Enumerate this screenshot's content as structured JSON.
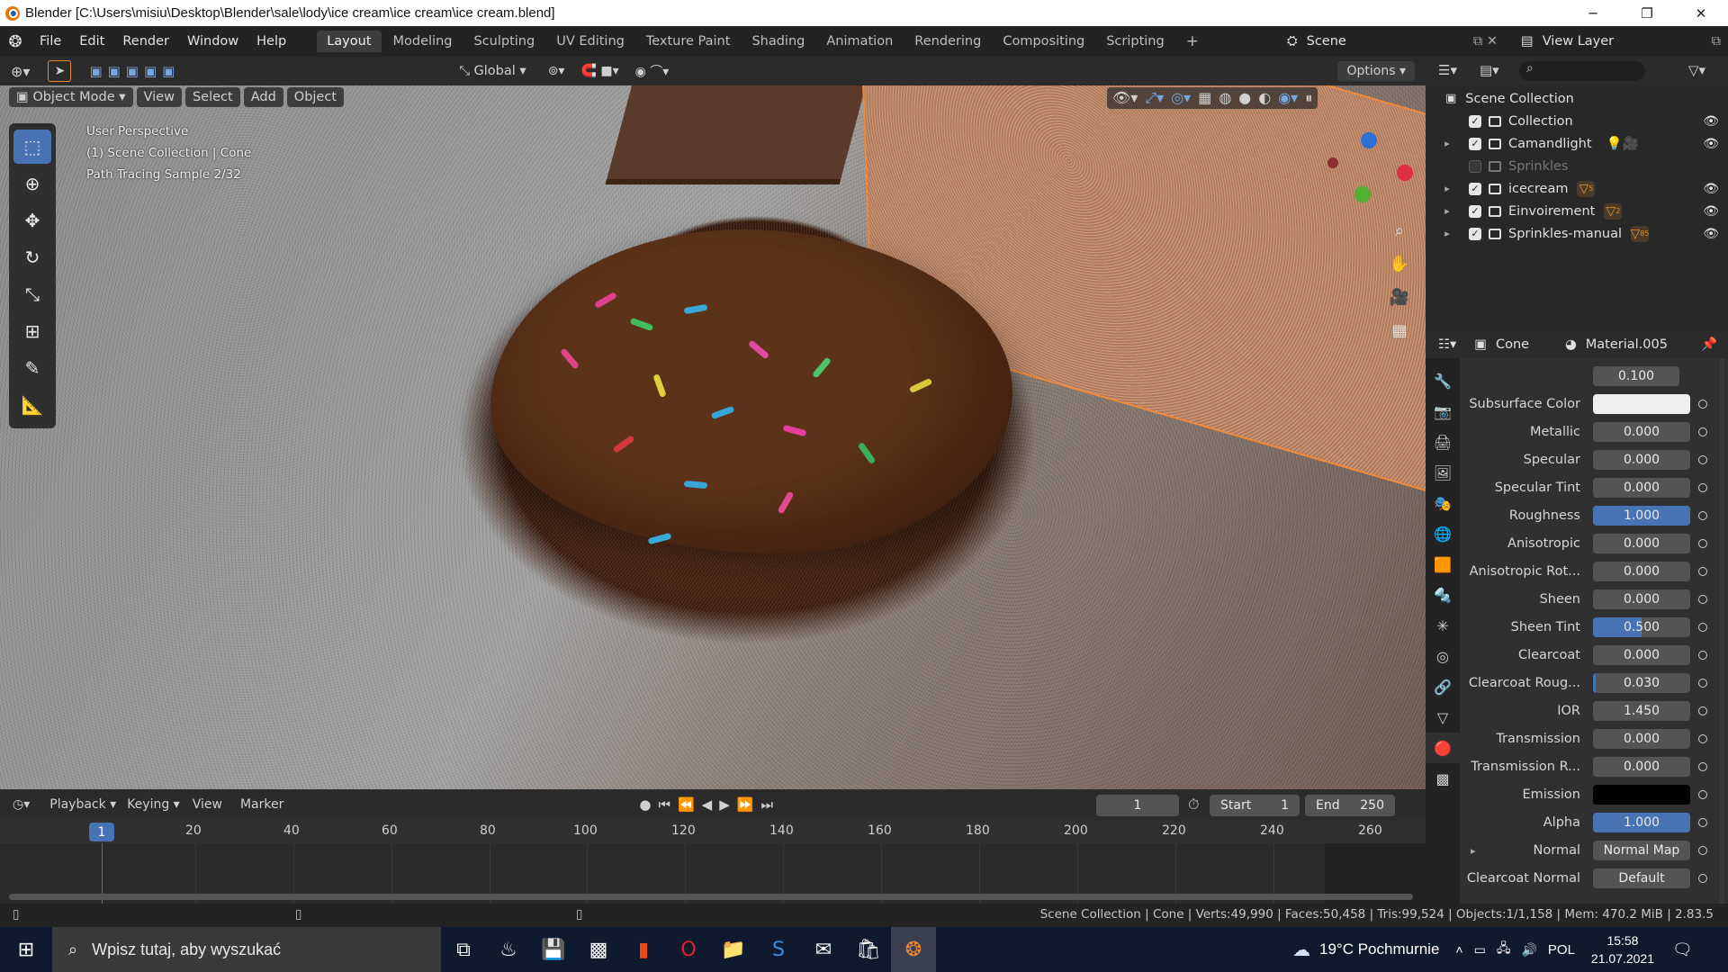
{
  "window": {
    "title": "Blender [C:\\Users\\misiu\\Desktop\\Blender\\sale\\lody\\ice cream\\ice cream\\ice cream.blend]",
    "minimize": "─",
    "maximize": "❐",
    "close": "✕"
  },
  "menu": [
    "File",
    "Edit",
    "Render",
    "Window",
    "Help"
  ],
  "workspaces": [
    "Layout",
    "Modeling",
    "Sculpting",
    "UV Editing",
    "Texture Paint",
    "Shading",
    "Animation",
    "Rendering",
    "Compositing",
    "Scripting"
  ],
  "workspace_add": "+",
  "scene_name": "Scene",
  "view_layer": "View Layer",
  "viewport": {
    "transform_orientation": "Global",
    "options": "Options",
    "mode": "Object Mode",
    "menus": [
      "View",
      "Select",
      "Add",
      "Object"
    ],
    "overlay_lines": [
      "User Perspective",
      "(1) Scene Collection | Cone",
      "Path Tracing Sample 2/32"
    ]
  },
  "timeline": {
    "menus": [
      "Playback",
      "Keying",
      "View",
      "Marker"
    ],
    "current_frame": "1",
    "start_label": "Start",
    "start": "1",
    "end_label": "End",
    "end": "250",
    "ticks": [
      "20",
      "40",
      "60",
      "80",
      "100",
      "120",
      "140",
      "160",
      "180",
      "200",
      "220",
      "240",
      "260"
    ],
    "playhead": "1"
  },
  "status": "Scene Collection | Cone | Verts:49,990 | Faces:50,458 | Tris:99,524 | Objects:1/1,158 | Mem: 470.2 MiB | 2.83.5",
  "outliner": {
    "root": "Scene Collection",
    "items": [
      {
        "label": "Collection",
        "checked": true,
        "expand": ""
      },
      {
        "label": "Camandlight",
        "checked": true,
        "expand": "▸"
      },
      {
        "label": "Sprinkles",
        "checked": false,
        "expand": ""
      },
      {
        "label": "icecream",
        "checked": true,
        "expand": "▸",
        "badge": "5"
      },
      {
        "label": "Einvoirement",
        "checked": true,
        "expand": "▸",
        "badge": "2"
      },
      {
        "label": "Sprinkles-manual",
        "checked": true,
        "expand": "▸",
        "badge": "85"
      }
    ]
  },
  "properties": {
    "object": "Cone",
    "material": "Material.005",
    "top_value": "0.100",
    "rows": [
      {
        "label": "Subsurface Color",
        "value": "",
        "fill": 0,
        "swatch": "#f0f0f0"
      },
      {
        "label": "Metallic",
        "value": "0.000",
        "fill": 0
      },
      {
        "label": "Specular",
        "value": "0.000",
        "fill": 0
      },
      {
        "label": "Specular Tint",
        "value": "0.000",
        "fill": 0
      },
      {
        "label": "Roughness",
        "value": "1.000",
        "fill": 1.0
      },
      {
        "label": "Anisotropic",
        "value": "0.000",
        "fill": 0
      },
      {
        "label": "Anisotropic Rot...",
        "value": "0.000",
        "fill": 0
      },
      {
        "label": "Sheen",
        "value": "0.000",
        "fill": 0
      },
      {
        "label": "Sheen Tint",
        "value": "0.500",
        "fill": 0.5
      },
      {
        "label": "Clearcoat",
        "value": "0.000",
        "fill": 0
      },
      {
        "label": "Clearcoat Roug...",
        "value": "0.030",
        "fill": 0.03
      },
      {
        "label": "IOR",
        "value": "1.450",
        "fill": 0
      },
      {
        "label": "Transmission",
        "value": "0.000",
        "fill": 0
      },
      {
        "label": "Transmission R...",
        "value": "0.000",
        "fill": 0
      },
      {
        "label": "Emission",
        "value": "",
        "fill": 0,
        "swatch": "#000000"
      },
      {
        "label": "Alpha",
        "value": "1.000",
        "fill": 1.0
      },
      {
        "label": "Normal",
        "value": "Normal Map",
        "fill": 0
      },
      {
        "label": "Clearcoat Normal",
        "value": "Default",
        "fill": 0
      }
    ]
  },
  "taskbar": {
    "search_placeholder": "Wpisz tutaj, aby wyszukać",
    "weather": "19°C Pochmurnie",
    "lang": "POL",
    "time": "15:58",
    "date": "21.07.2021"
  },
  "colors": {
    "accent": "#4772b3",
    "selection": "#f08a3a",
    "taskbar": "#101a2e"
  }
}
